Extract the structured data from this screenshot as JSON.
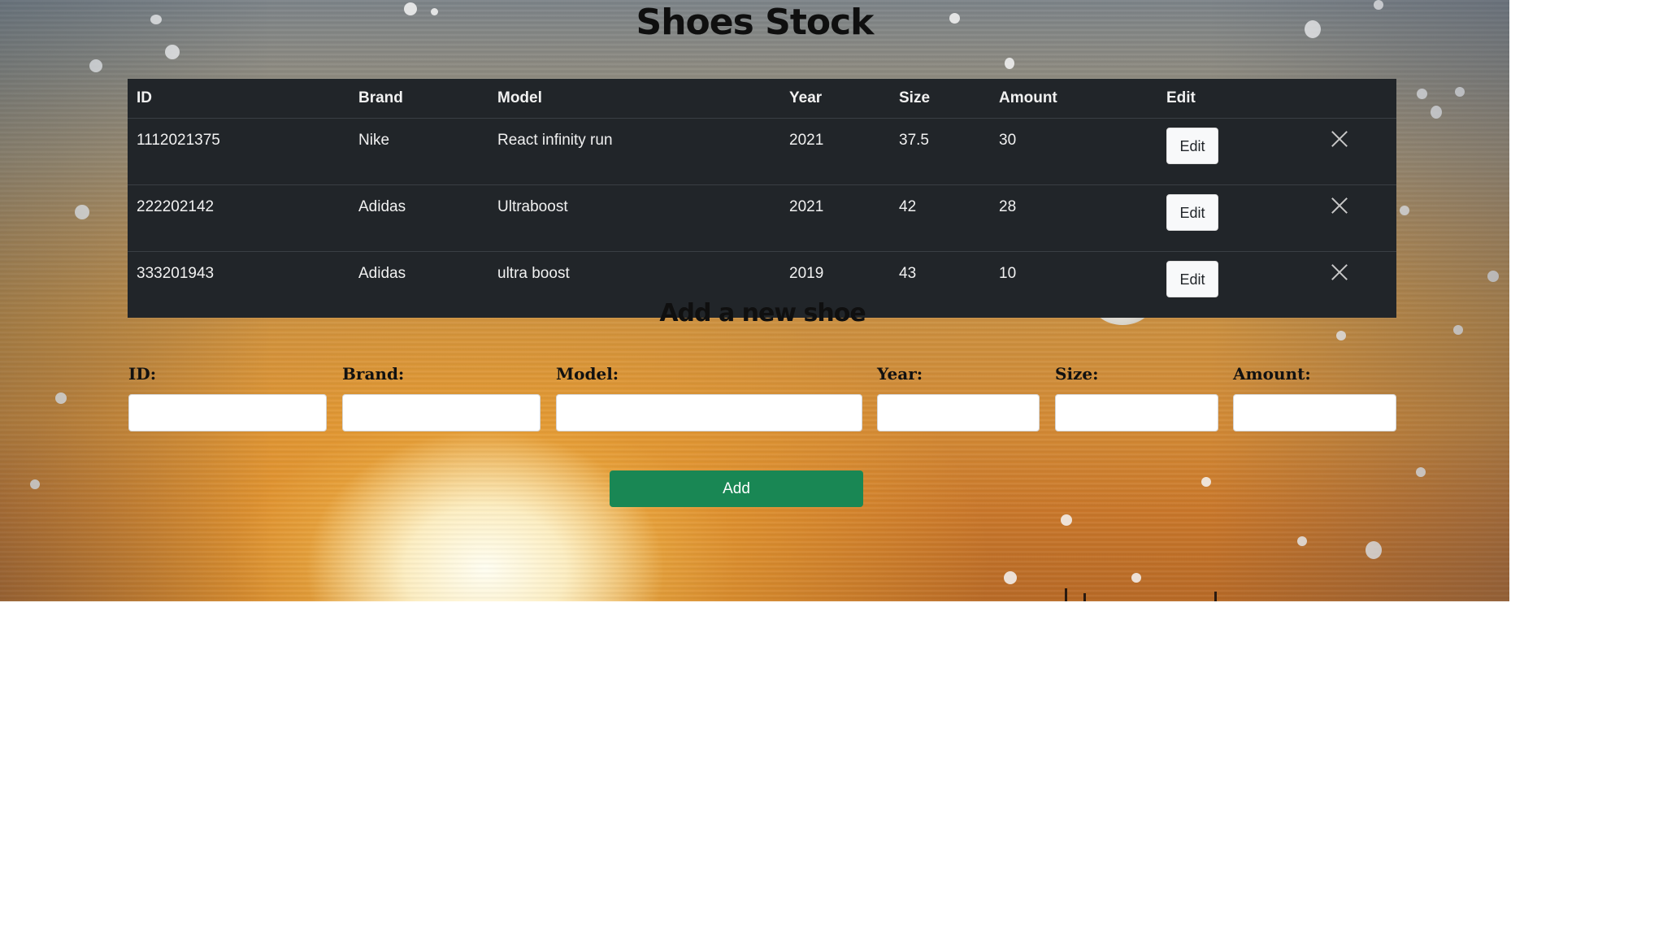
{
  "page": {
    "title": "Shoes Stock"
  },
  "table": {
    "headers": [
      "ID",
      "Brand",
      "Model",
      "Year",
      "Size",
      "Amount",
      "Edit"
    ],
    "rows": [
      {
        "id": "1112021375",
        "brand": "Nike",
        "model": "React infinity run",
        "year": "2021",
        "size": "37.5",
        "amount": "30",
        "edit_label": "Edit"
      },
      {
        "id": "222202142",
        "brand": "Adidas",
        "model": "Ultraboost",
        "year": "2021",
        "size": "42",
        "amount": "28",
        "edit_label": "Edit"
      },
      {
        "id": "333201943",
        "brand": "Adidas",
        "model": "ultra boost",
        "year": "2019",
        "size": "43",
        "amount": "10",
        "edit_label": "Edit"
      }
    ],
    "delete_icon": "close-icon"
  },
  "form": {
    "title": "Add a new shoe",
    "fields": {
      "id": {
        "label": "ID:",
        "value": ""
      },
      "brand": {
        "label": "Brand:",
        "value": ""
      },
      "model": {
        "label": "Model:",
        "value": ""
      },
      "year": {
        "label": "Year:",
        "value": ""
      },
      "size": {
        "label": "Size:",
        "value": ""
      },
      "amount": {
        "label": "Amount:",
        "value": ""
      }
    },
    "submit_label": "Add"
  },
  "colors": {
    "table_bg": "#212529",
    "add_button": "#198754",
    "edit_button": "#f8f9fa"
  }
}
